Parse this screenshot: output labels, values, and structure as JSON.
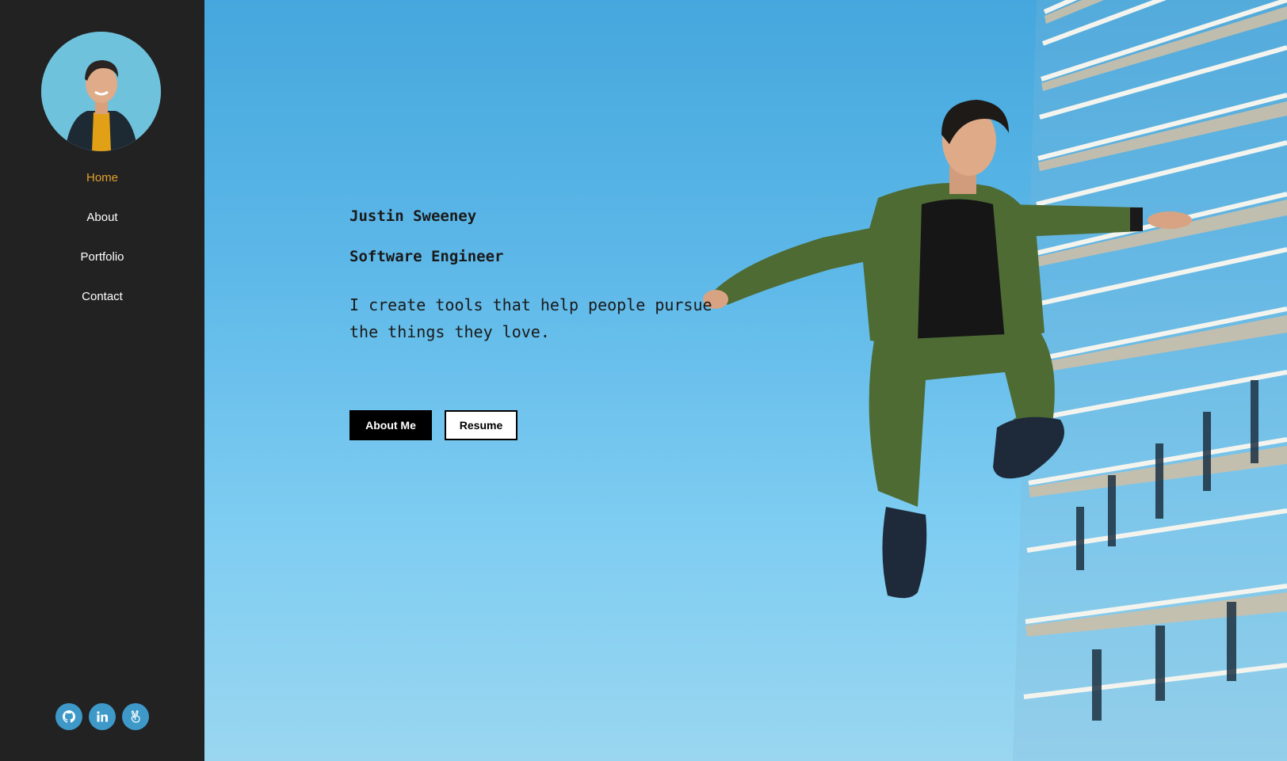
{
  "sidebar": {
    "nav": [
      {
        "label": "Home",
        "active": true
      },
      {
        "label": "About"
      },
      {
        "label": "Portfolio"
      },
      {
        "label": "Contact"
      }
    ],
    "socials": [
      "github-icon",
      "linkedin-icon",
      "angellist-icon"
    ]
  },
  "hero": {
    "name": "Justin Sweeney",
    "title": "Software Engineer",
    "tagline": "I create tools that help people pursue the things they love.",
    "about_button": "About Me",
    "resume_button": "Resume"
  },
  "colors": {
    "sidebar_bg": "#222222",
    "nav_active": "#e2a02e",
    "social_bg": "#3e99c9",
    "sky": "#5db8e8"
  }
}
